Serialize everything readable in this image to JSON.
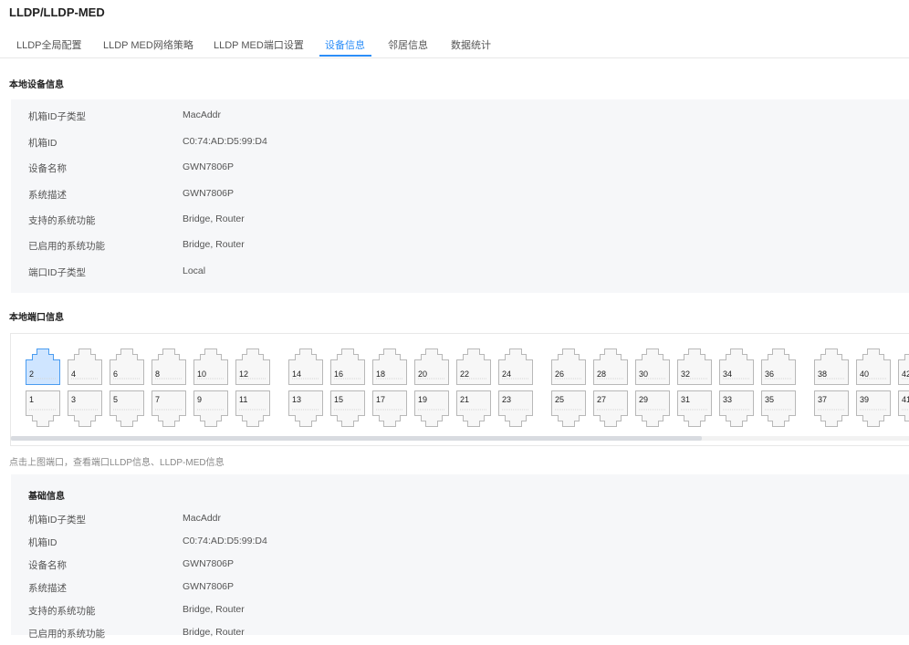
{
  "page_title": "LLDP/LLDP-MED",
  "tabs": [
    {
      "label": "LLDP全局配置"
    },
    {
      "label": "LLDP MED网络策略"
    },
    {
      "label": "LLDP MED端口设置"
    },
    {
      "label": "设备信息",
      "active": true
    },
    {
      "label": "邻居信息"
    },
    {
      "label": "数据统计"
    }
  ],
  "local_device": {
    "title": "本地设备信息",
    "rows": [
      {
        "label": "机箱ID子类型",
        "value": "MacAddr"
      },
      {
        "label": "机箱ID",
        "value": "C0:74:AD:D5:99:D4"
      },
      {
        "label": "设备名称",
        "value": "GWN7806P"
      },
      {
        "label": "系统描述",
        "value": "GWN7806P"
      },
      {
        "label": "支持的系统功能",
        "value": "Bridge, Router"
      },
      {
        "label": "已启用的系统功能",
        "value": "Bridge, Router"
      },
      {
        "label": "端口ID子类型",
        "value": "Local"
      }
    ]
  },
  "local_port": {
    "title": "本地端口信息",
    "top_ports": [
      "2",
      "4",
      "6",
      "8",
      "10",
      "12",
      "14",
      "16",
      "18",
      "20",
      "22",
      "24",
      "26",
      "28",
      "30",
      "32",
      "34",
      "36",
      "38",
      "40",
      "42"
    ],
    "bottom_ports": [
      "1",
      "3",
      "5",
      "7",
      "9",
      "11",
      "13",
      "15",
      "17",
      "19",
      "21",
      "23",
      "25",
      "27",
      "29",
      "31",
      "33",
      "35",
      "37",
      "39",
      "41"
    ],
    "selected_port": "2",
    "hint": "点击上图端口，查看端口LLDP信息、LLDP-MED信息"
  },
  "basic_info": {
    "title": "基础信息",
    "rows": [
      {
        "label": "机箱ID子类型",
        "value": "MacAddr"
      },
      {
        "label": "机箱ID",
        "value": "C0:74:AD:D5:99:D4"
      },
      {
        "label": "设备名称",
        "value": "GWN7806P"
      },
      {
        "label": "系统描述",
        "value": "GWN7806P"
      },
      {
        "label": "支持的系统功能",
        "value": "Bridge, Router"
      },
      {
        "label": "已启用的系统功能",
        "value": "Bridge, Router"
      }
    ]
  },
  "colors": {
    "accent": "#2c8ef8",
    "panel_bg": "#f6f7f9"
  }
}
